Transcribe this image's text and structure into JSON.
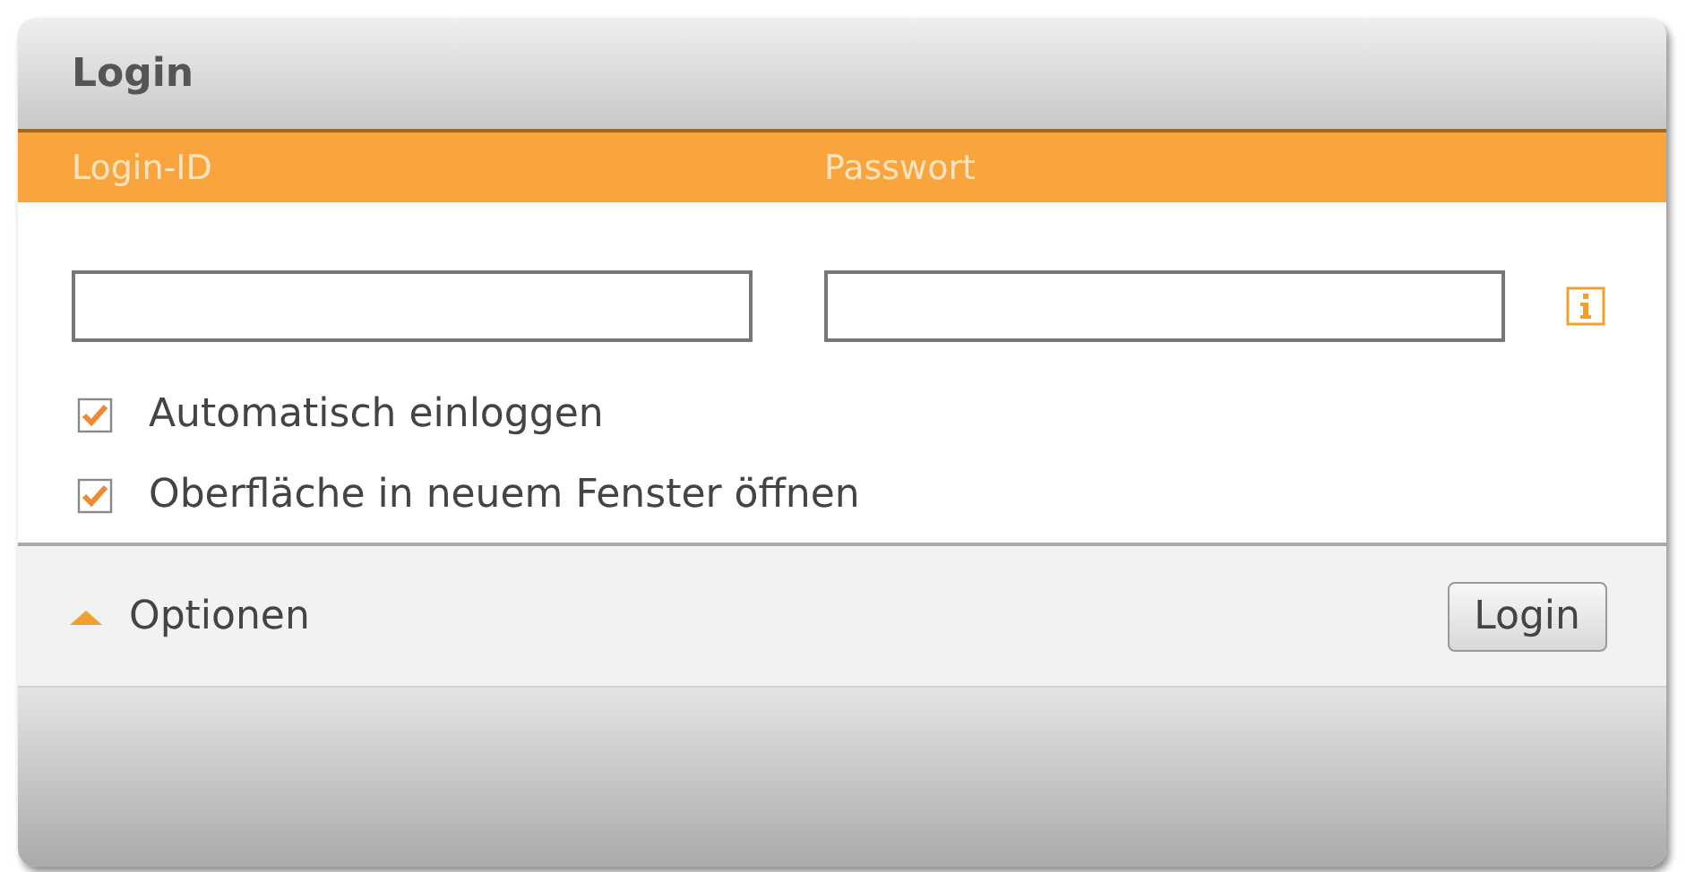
{
  "header": {
    "title": "Login"
  },
  "labels": [
    "Login-ID",
    "Passwort"
  ],
  "options": [
    {
      "label": "Automatisch einloggen",
      "checked": true
    },
    {
      "label": "Oberfläche in neuem Fenster öffnen",
      "checked": true
    }
  ],
  "footer": {
    "toggle": "Optionen",
    "expanded": true,
    "button": "Login"
  }
}
